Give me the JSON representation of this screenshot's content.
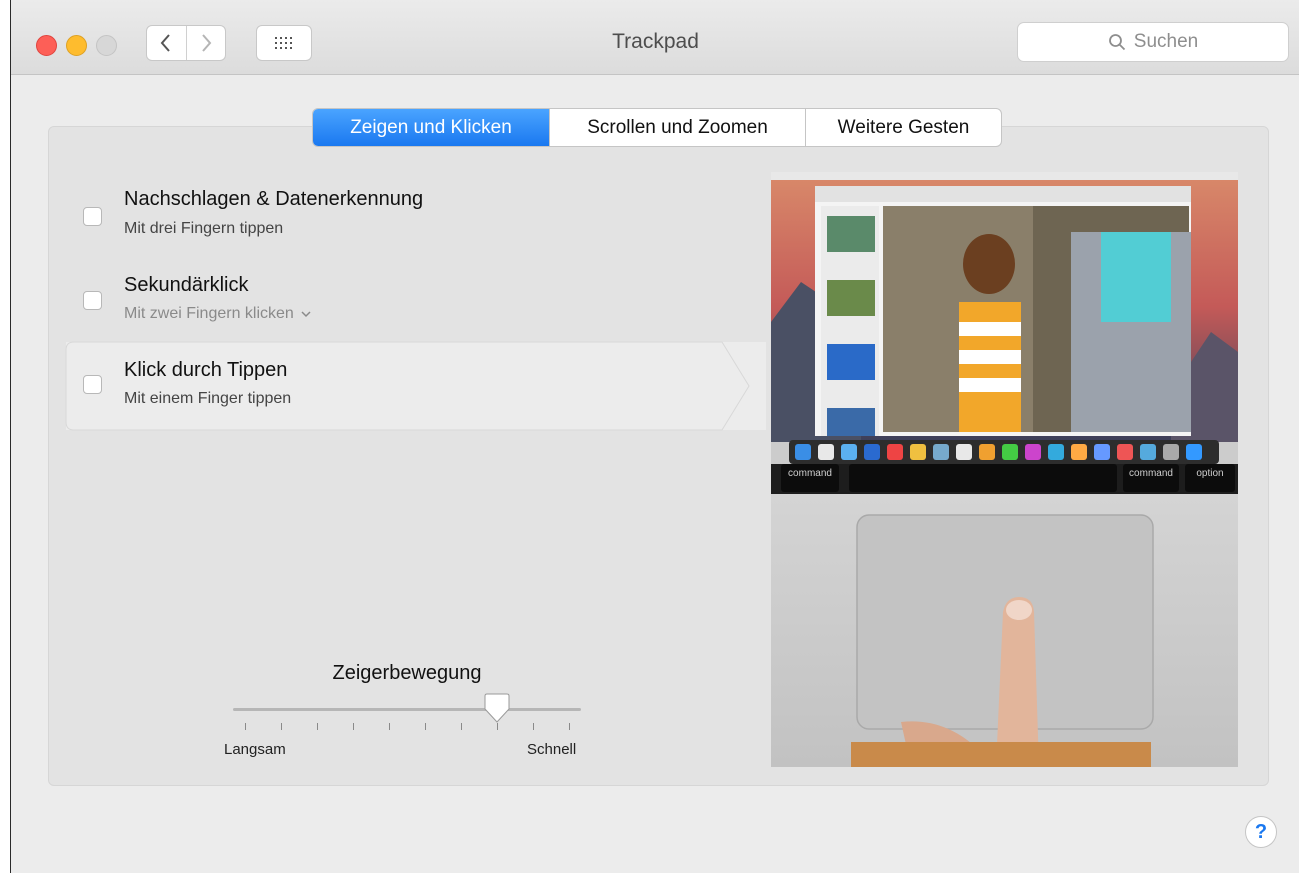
{
  "window": {
    "title": "Trackpad"
  },
  "search": {
    "placeholder": "Suchen"
  },
  "tabs": [
    {
      "label": "Zeigen und Klicken",
      "active": true
    },
    {
      "label": "Scrollen und Zoomen",
      "active": false
    },
    {
      "label": "Weitere Gesten",
      "active": false
    }
  ],
  "options": [
    {
      "title": "Nachschlagen & Datenerkennung",
      "subtitle": "Mit drei Fingern tippen",
      "checked": false
    },
    {
      "title": "Sekundärklick",
      "subtitle": "Mit zwei Fingern klicken",
      "checked": false,
      "has_dropdown": true
    },
    {
      "title": "Klick durch Tippen",
      "subtitle": "Mit einem Finger tippen",
      "checked": false,
      "selected": true
    }
  ],
  "tracking_speed": {
    "label": "Zeigerbewegung",
    "min_label": "Langsam",
    "max_label": "Schnell",
    "tick_count": 10,
    "selected_tick": 7
  },
  "preview": {
    "keys": [
      "command",
      "command",
      "option"
    ]
  },
  "help": {
    "label": "?"
  },
  "colors": {
    "accent": "#1a78f0",
    "close": "#fd5f57",
    "minimize": "#febc2e"
  },
  "icons": [
    "back-chevron-icon",
    "forward-chevron-icon",
    "grid-icon",
    "search-icon",
    "chevron-down-icon",
    "help-icon"
  ]
}
